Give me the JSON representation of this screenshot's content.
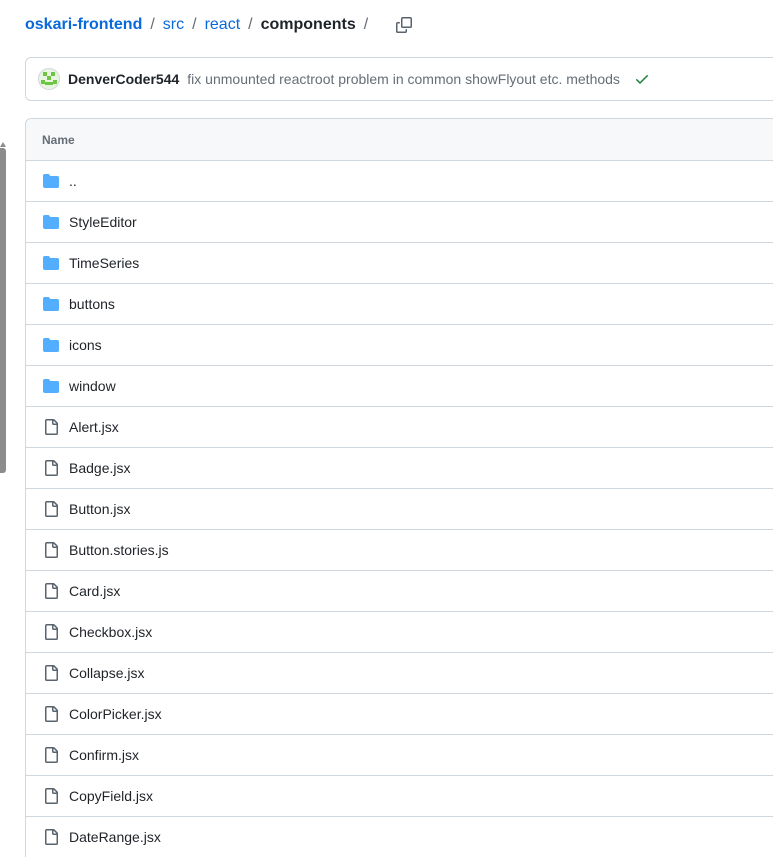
{
  "breadcrumb": {
    "root": "oskari-frontend",
    "parts": [
      "src",
      "react"
    ],
    "current": "components",
    "separator": "/"
  },
  "commit": {
    "author": "DenverCoder544",
    "message": "fix unmounted reactroot problem in common showFlyout etc. methods",
    "status": "success"
  },
  "table": {
    "header": "Name",
    "rows": [
      {
        "name": "..",
        "type": "folder"
      },
      {
        "name": "StyleEditor",
        "type": "folder"
      },
      {
        "name": "TimeSeries",
        "type": "folder"
      },
      {
        "name": "buttons",
        "type": "folder"
      },
      {
        "name": "icons",
        "type": "folder"
      },
      {
        "name": "window",
        "type": "folder"
      },
      {
        "name": "Alert.jsx",
        "type": "file"
      },
      {
        "name": "Badge.jsx",
        "type": "file"
      },
      {
        "name": "Button.jsx",
        "type": "file"
      },
      {
        "name": "Button.stories.js",
        "type": "file"
      },
      {
        "name": "Card.jsx",
        "type": "file"
      },
      {
        "name": "Checkbox.jsx",
        "type": "file"
      },
      {
        "name": "Collapse.jsx",
        "type": "file"
      },
      {
        "name": "ColorPicker.jsx",
        "type": "file"
      },
      {
        "name": "Confirm.jsx",
        "type": "file"
      },
      {
        "name": "CopyField.jsx",
        "type": "file"
      },
      {
        "name": "DateRange.jsx",
        "type": "file"
      }
    ]
  },
  "colors": {
    "link": "#0969da",
    "folder": "#54aeff",
    "success": "#1a7f37",
    "border": "#d0d7de"
  },
  "icons": {
    "folder": "folder-icon",
    "file": "file-icon",
    "copy": "copy-icon",
    "check": "check-icon"
  }
}
